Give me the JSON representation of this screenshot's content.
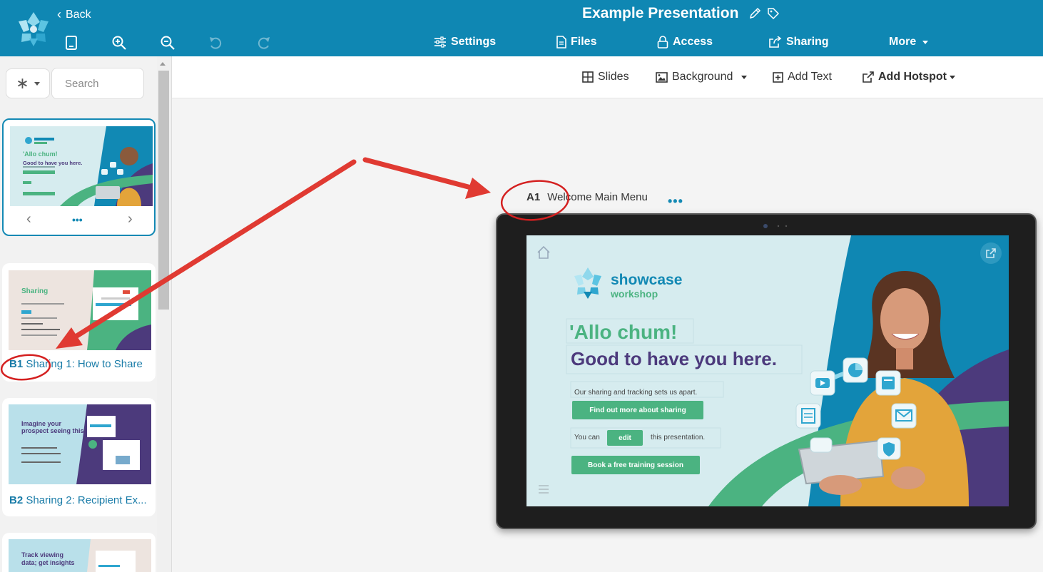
{
  "header": {
    "back_label": "Back",
    "title": "Example Presentation",
    "nav": {
      "settings": "Settings",
      "files": "Files",
      "access": "Access",
      "sharing": "Sharing",
      "more": "More"
    }
  },
  "toolbar": {
    "slides": "Slides",
    "background": "Background",
    "add_text": "Add Text",
    "add_hotspot": "Add Hotspot"
  },
  "sidebar": {
    "filter_symbol": "∗",
    "search_placeholder": "Search",
    "slides": [
      {
        "code": "",
        "title": "",
        "nav_more": "•••"
      },
      {
        "code": "B1",
        "title": "Sharing 1: How to Share"
      },
      {
        "code": "B2",
        "title": "Sharing 2: Recipient Ex..."
      }
    ],
    "thumb_texts": {
      "a1_line1": "'Allo chum!",
      "a1_line2": "Good to have you here.",
      "b1_title": "Sharing",
      "b2_title": "Imagine your prospect seeing this",
      "b3_title": "Track viewing data; get insights"
    }
  },
  "canvas": {
    "slide_code": "A1",
    "slide_title": "Welcome Main Menu",
    "more": "•••",
    "slide": {
      "brand_line1": "showcase",
      "brand_line2": "workshop",
      "greeting": "'Allo chum!",
      "headline": "Good to have you here.",
      "tagline": "Our sharing and tracking sets us apart.",
      "find_out_button": "Find out more about sharing",
      "you_can": "You can",
      "edit_button": "edit",
      "this_presentation": "this presentation.",
      "book_button": "Book a free training session"
    }
  },
  "colors": {
    "brand_blue": "#0f87b3",
    "green": "#4bb381",
    "purple": "#4c3a7c",
    "annotation_red": "#e03a32"
  }
}
